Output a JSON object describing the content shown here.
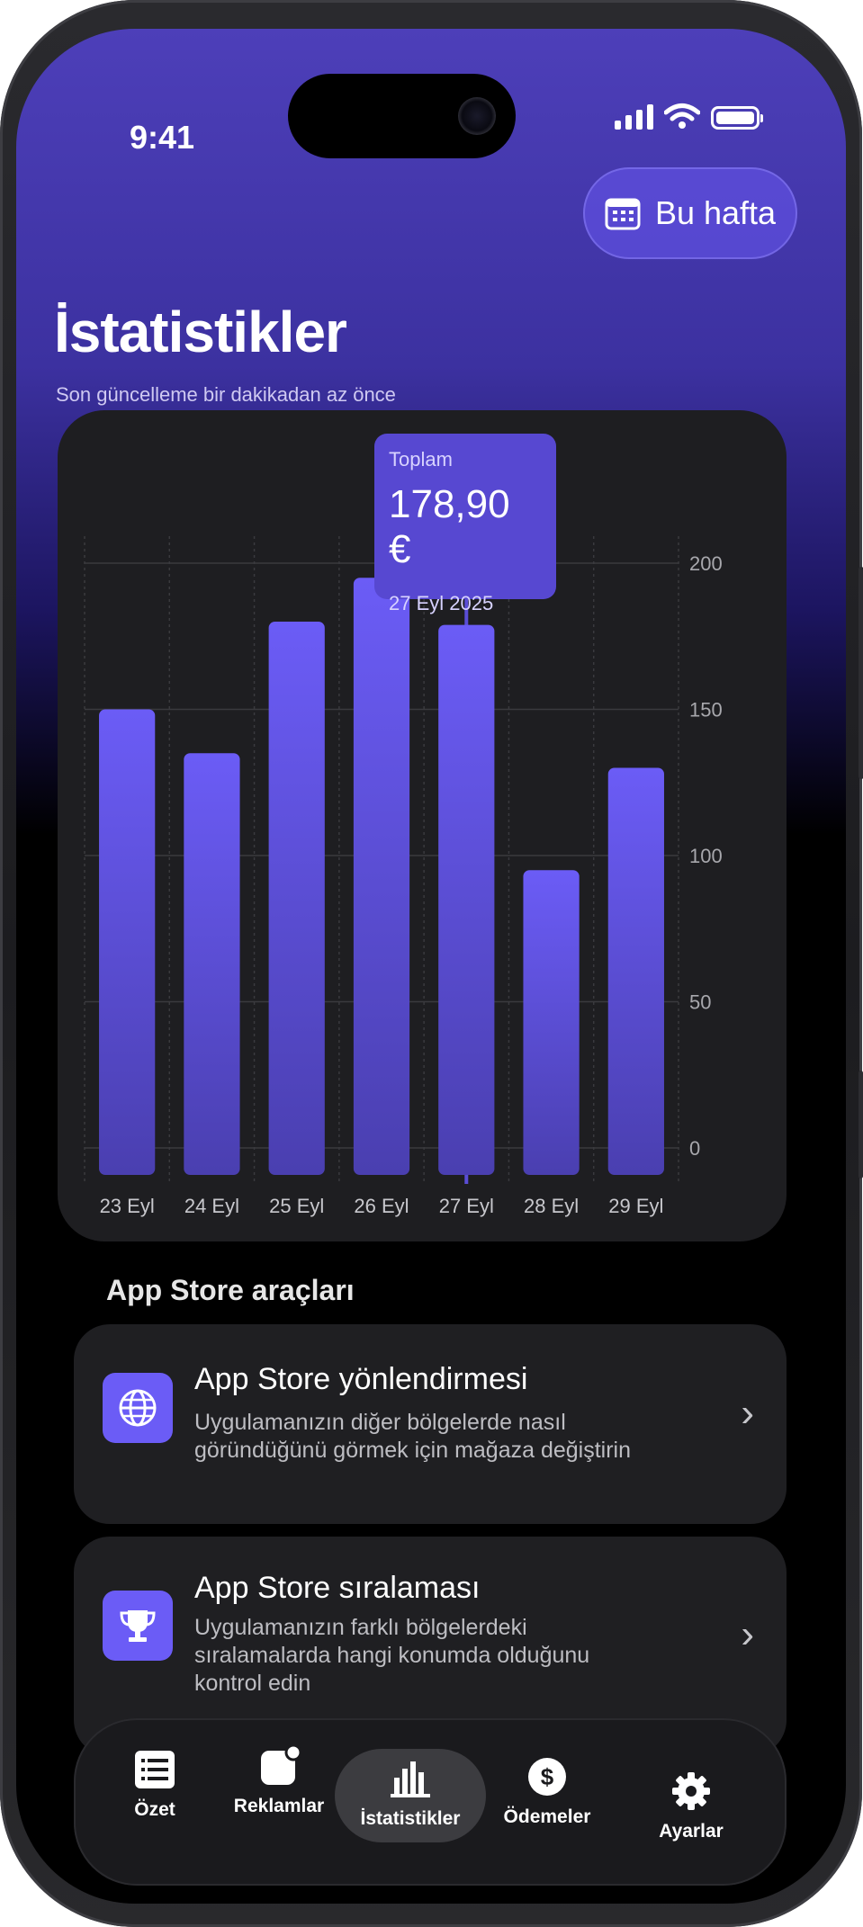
{
  "status_bar": {
    "time": "9:41"
  },
  "header": {
    "week_button_label": "Bu hafta",
    "title": "İstatistikler",
    "subtitle": "Son güncelleme bir dakikadan az önce"
  },
  "tooltip": {
    "label": "Toplam",
    "value": "178,90 €",
    "date": "27 Eyl 2025"
  },
  "chart_data": {
    "type": "bar",
    "categories": [
      "23 Eyl",
      "24 Eyl",
      "25 Eyl",
      "26 Eyl",
      "27 Eyl",
      "28 Eyl",
      "29 Eyl"
    ],
    "values": [
      150,
      135,
      180,
      195,
      178.9,
      95,
      130
    ],
    "ylim": [
      0,
      200
    ],
    "yticks": [
      0,
      50,
      100,
      150,
      200
    ],
    "selected_index": 4,
    "bar_color": "#6b5cf6"
  },
  "tools": {
    "section_title": "App Store araçları",
    "items": [
      {
        "title": "App Store yönlendirmesi",
        "description": "Uygulamanızın diğer bölgelerde nasıl göründüğünü görmek için mağaza değiştirin",
        "icon": "globe-icon"
      },
      {
        "title": "App Store sıralaması",
        "description": "Uygulamanızın farklı bölgelerdeki sıralamalarda hangi konumda olduğunu kontrol edin",
        "icon": "trophy-icon"
      }
    ]
  },
  "tab_bar": {
    "items": [
      {
        "label": "Özet",
        "icon": "list-icon"
      },
      {
        "label": "Reklamlar",
        "icon": "ads-icon"
      },
      {
        "label": "İstatistikler",
        "icon": "bar-chart-icon",
        "active": true
      },
      {
        "label": "Ödemeler",
        "icon": "dollar-icon"
      },
      {
        "label": "Ayarlar",
        "icon": "gear-icon"
      }
    ]
  },
  "colors": {
    "accent": "#6b5cf6",
    "header_top": "#4d3fb9",
    "card_bg": "#1e1e21"
  }
}
